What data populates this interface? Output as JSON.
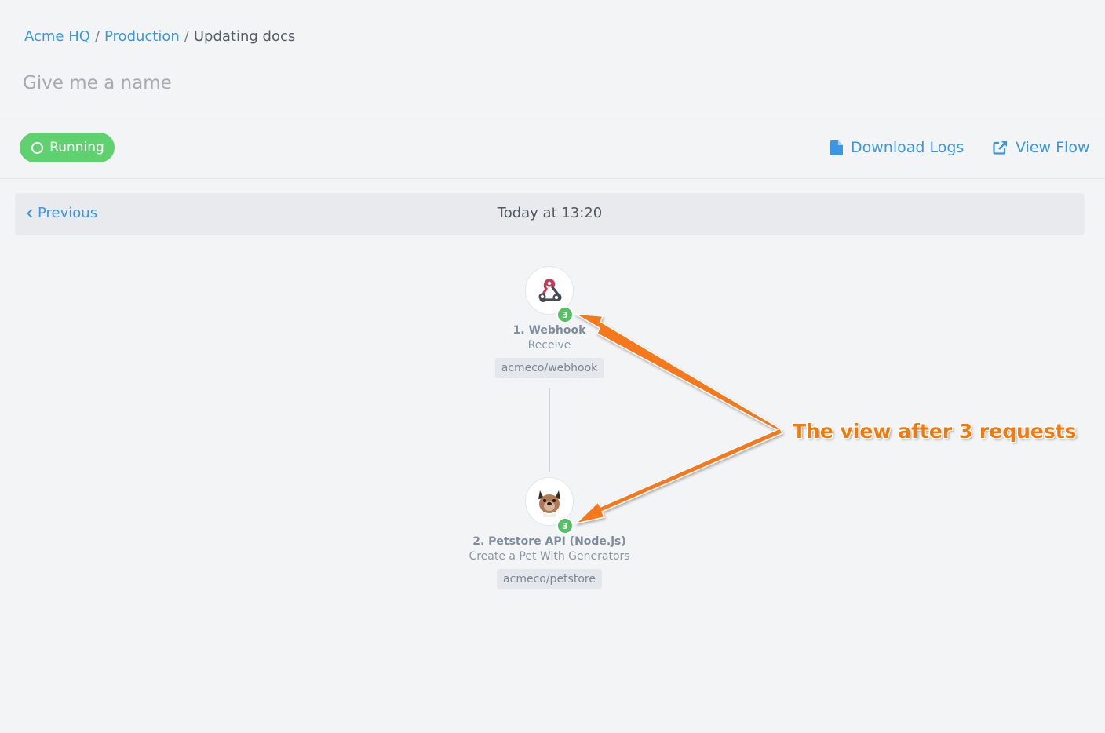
{
  "breadcrumb": {
    "org": "Acme HQ",
    "environment": "Production",
    "current": "Updating docs"
  },
  "name_field": {
    "value": "",
    "placeholder": "Give me a name"
  },
  "status": {
    "label": "Running",
    "color": "#5fd16e"
  },
  "actions": {
    "download_logs": "Download Logs",
    "view_flow": "View Flow"
  },
  "pager": {
    "previous": "Previous",
    "date": "Today at 13:20"
  },
  "nodes": [
    {
      "title": "1. Webhook",
      "subtitle": "Receive",
      "tag": "acmeco/webhook",
      "count": "3",
      "icon": "webhook-icon"
    },
    {
      "title": "2. Petstore API (Node.js)",
      "subtitle": "Create a Pet With Generators",
      "tag": "acmeco/petstore",
      "count": "3",
      "icon": "dog-avatar-icon"
    }
  ],
  "annotation": {
    "text": "The view after 3 requests",
    "color": "#f07a12"
  },
  "colors": {
    "accent": "#3b97e3",
    "success": "#56c065",
    "background": "#f3f4f6"
  }
}
